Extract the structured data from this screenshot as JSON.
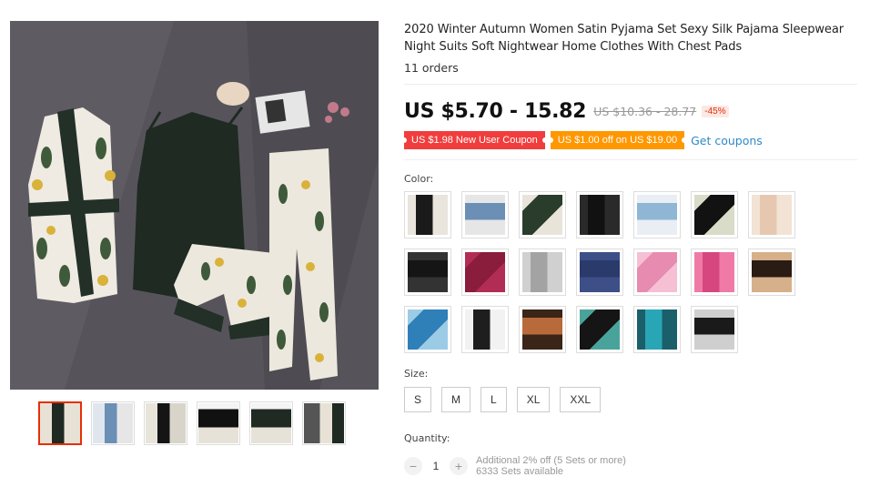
{
  "product": {
    "title": "2020 Winter Autumn Women Satin Pyjama Set Sexy Silk Pajama Sleepwear Night Suits Soft Nightwear Home Clothes With Chest Pads",
    "orders": "11 orders"
  },
  "price": {
    "current": "US $5.70 - 15.82",
    "original": "US $10.36 - 28.77",
    "discount": "-45%"
  },
  "coupons": {
    "new_user": "US $1.98 New User Coupon",
    "off": "US $1.00 off on US $19.00",
    "get_link": "Get coupons"
  },
  "color": {
    "label": "Color:",
    "swatches": [
      {
        "name": "black-floral-set",
        "colors": [
          "#1a1a1a",
          "#e9e4dc"
        ]
      },
      {
        "name": "blue-floral-set",
        "colors": [
          "#6b8fb5",
          "#e6e6e6"
        ]
      },
      {
        "name": "green-floral-set",
        "colors": [
          "#2a3d2c",
          "#e8e4da"
        ]
      },
      {
        "name": "black-cami-set",
        "colors": [
          "#111111",
          "#2a2a2a"
        ]
      },
      {
        "name": "light-blue-set",
        "colors": [
          "#8fb6d4",
          "#e8eef3"
        ]
      },
      {
        "name": "black-white-set",
        "colors": [
          "#121212",
          "#d9dcc8"
        ]
      },
      {
        "name": "champagne-set",
        "colors": [
          "#e6c8b0",
          "#f3e3d5"
        ]
      },
      {
        "name": "black-robe-set",
        "colors": [
          "#151515",
          "#333333"
        ]
      },
      {
        "name": "wine-red-set",
        "colors": [
          "#8a1c3c",
          "#b22d55"
        ]
      },
      {
        "name": "grey-set",
        "colors": [
          "#a3a3a3",
          "#d0d0d0"
        ]
      },
      {
        "name": "navy-set",
        "colors": [
          "#2a3a6b",
          "#3d4f86"
        ]
      },
      {
        "name": "pink-set",
        "colors": [
          "#e88bb0",
          "#f5c0d4"
        ]
      },
      {
        "name": "rose-set",
        "colors": [
          "#d6477f",
          "#f07aa6"
        ]
      },
      {
        "name": "leopard-black",
        "colors": [
          "#2a1b14",
          "#d6b08a"
        ]
      },
      {
        "name": "blue-print",
        "colors": [
          "#2f7fb8",
          "#9ccbe6"
        ]
      },
      {
        "name": "daisy-black",
        "colors": [
          "#1e1e1e",
          "#f2f2f2"
        ]
      },
      {
        "name": "leopard-brown",
        "colors": [
          "#b86a3a",
          "#3a2518"
        ]
      },
      {
        "name": "black-teal",
        "colors": [
          "#151515",
          "#4aa39a"
        ]
      },
      {
        "name": "teal-print",
        "colors": [
          "#28a6b5",
          "#1a5f6a"
        ]
      },
      {
        "name": "black-pattern",
        "colors": [
          "#1a1a1a",
          "#cfcfcf"
        ]
      }
    ]
  },
  "size": {
    "label": "Size:",
    "options": [
      "S",
      "M",
      "L",
      "XL",
      "XXL"
    ]
  },
  "quantity": {
    "label": "Quantity:",
    "value": "1",
    "minus": "−",
    "plus": "+",
    "note": "Additional 2% off (5 Sets or more)",
    "available": "6333 Sets available"
  }
}
